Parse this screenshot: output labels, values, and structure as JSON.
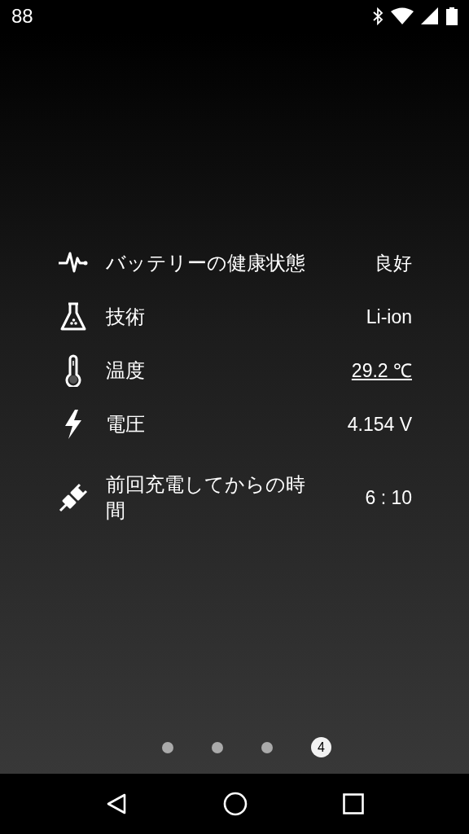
{
  "status_bar": {
    "time": "88"
  },
  "rows": [
    {
      "label": "バッテリーの健康状態",
      "value": "良好",
      "link": false
    },
    {
      "label": "技術",
      "value": "Li-ion",
      "link": false
    },
    {
      "label": "温度",
      "value": "29.2 ℃",
      "link": true
    },
    {
      "label": "電圧",
      "value": "4.154 V",
      "link": false
    },
    {
      "label": "前回充電してからの時間",
      "value": "6 : 10",
      "link": false
    }
  ],
  "pager": [
    {
      "selected": false
    },
    {
      "selected": false
    },
    {
      "selected": false
    },
    {
      "label": "4",
      "selected": true
    }
  ]
}
